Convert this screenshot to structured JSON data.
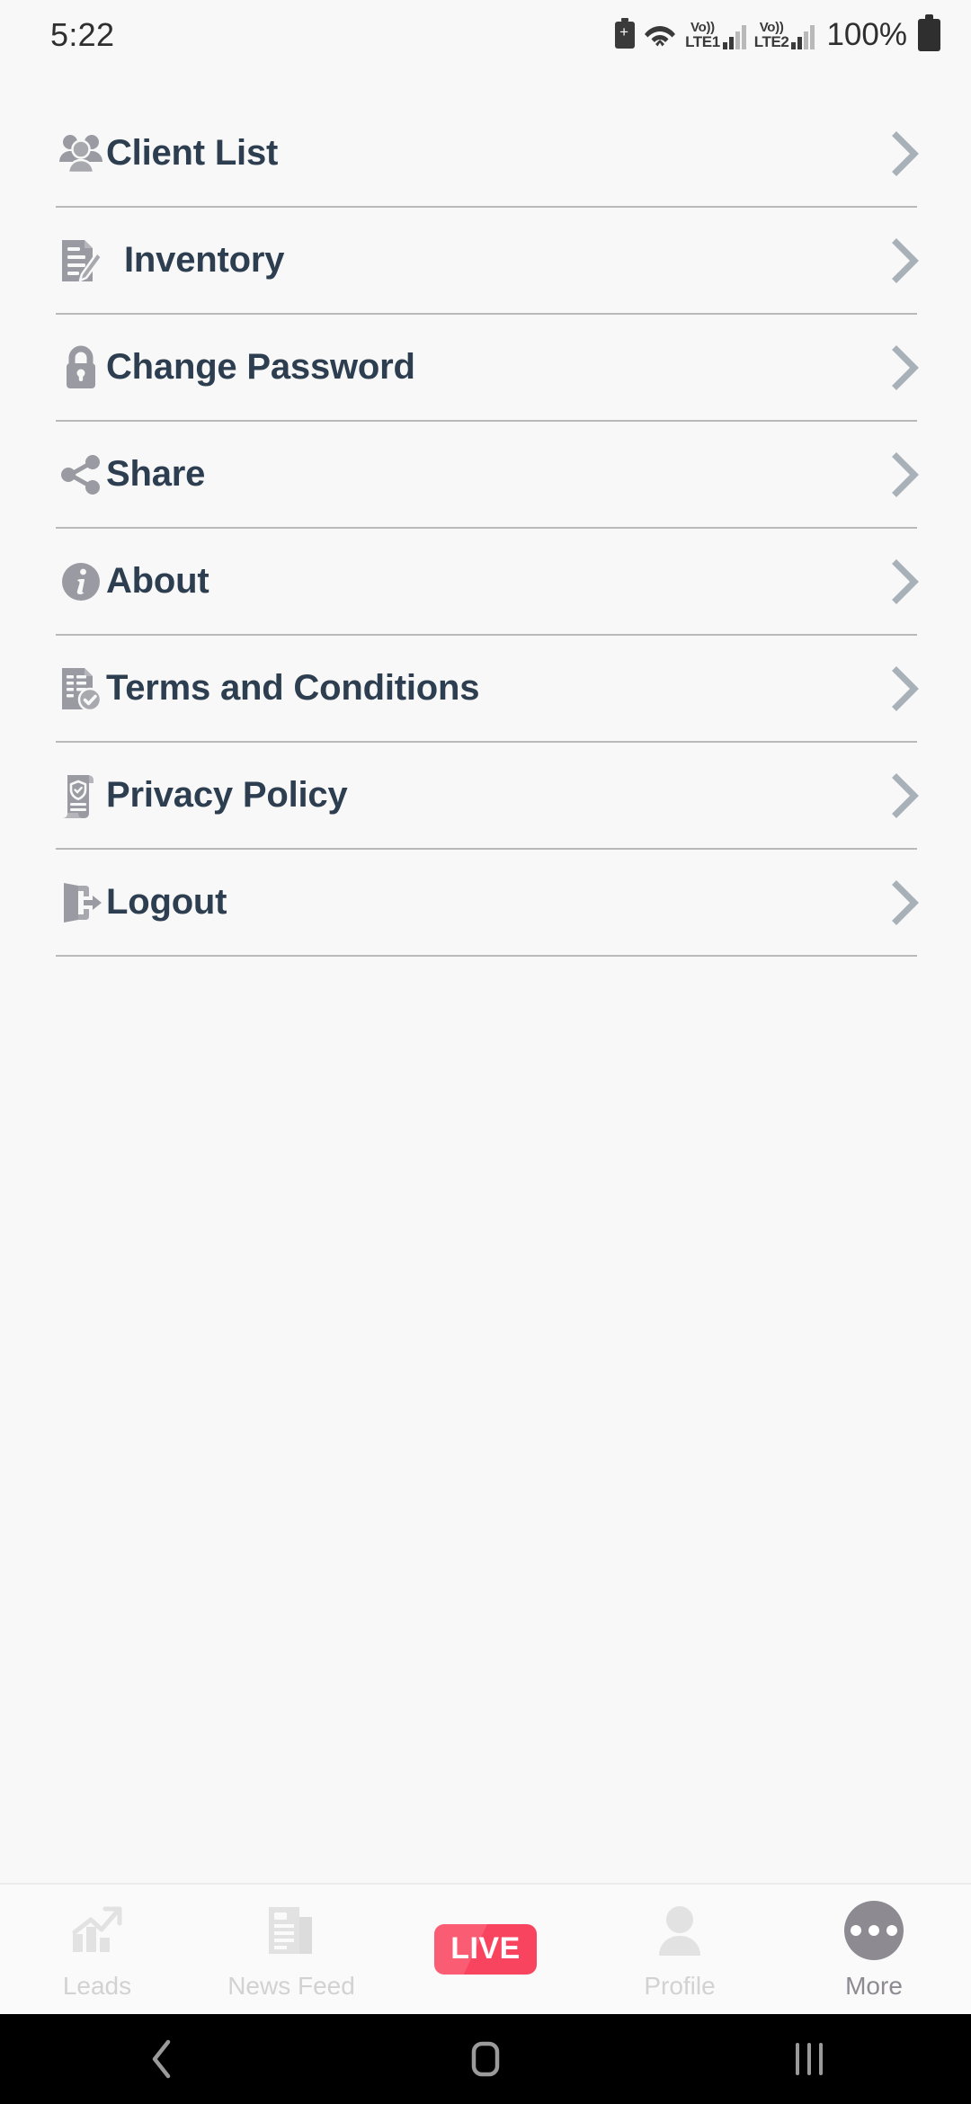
{
  "status_bar": {
    "time": "5:22",
    "battery_percent": "100%",
    "sim1": {
      "volte": "Vo))",
      "network": "LTE1"
    },
    "sim2": {
      "volte": "Vo))",
      "network": "LTE2"
    },
    "icons": [
      "battery-saver-icon",
      "wifi-icon",
      "signal-bars-icon",
      "battery-icon"
    ]
  },
  "menu": {
    "items": [
      {
        "label": "Client List",
        "icon": "users-group-icon",
        "chevron": "›"
      },
      {
        "label": "Inventory",
        "icon": "document-edit-icon",
        "chevron": "›"
      },
      {
        "label": "Change Password",
        "icon": "lock-icon",
        "chevron": "›"
      },
      {
        "label": "Share",
        "icon": "share-nodes-icon",
        "chevron": "›"
      },
      {
        "label": "About",
        "icon": "info-circle-icon",
        "chevron": "›"
      },
      {
        "label": "Terms and Conditions",
        "icon": "document-check-icon",
        "chevron": "›"
      },
      {
        "label": "Privacy Policy",
        "icon": "privacy-scroll-icon",
        "chevron": "›"
      },
      {
        "label": "Logout",
        "icon": "logout-door-icon",
        "chevron": "›"
      }
    ]
  },
  "tab_bar": {
    "tabs": [
      {
        "label": "Leads",
        "icon": "growth-chart-icon",
        "active": false
      },
      {
        "label": "News Feed",
        "icon": "newspaper-icon",
        "active": false
      },
      {
        "label": "LIVE",
        "icon": "live-badge-icon",
        "active": false
      },
      {
        "label": "Profile",
        "icon": "person-icon",
        "active": false
      },
      {
        "label": "More",
        "icon": "ellipsis-circle-icon",
        "active": true
      }
    ]
  },
  "nav_bar": {
    "back": "back-icon",
    "home": "home-icon",
    "recents": "recents-icon"
  },
  "colors": {
    "background": "#F8F8F8",
    "label_text": "#2d3e50",
    "icon_gray": "#9a9aa2",
    "divider": "#b9b9b9",
    "live_red": "#F9445F",
    "tab_inactive": "#d2d2d2",
    "tab_active": "#8d8a92"
  }
}
